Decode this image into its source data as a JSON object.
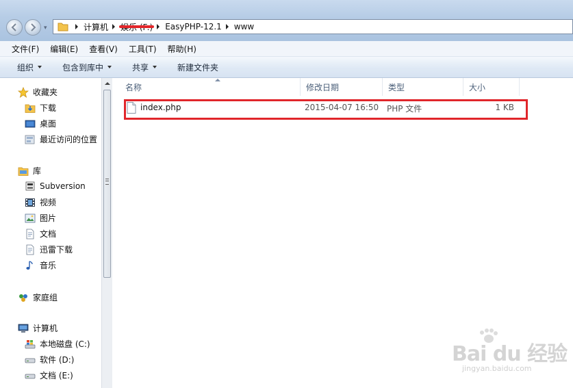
{
  "address_bar": {
    "breadcrumbs": [
      "计算机",
      "娱乐 (F:)",
      "EasyPHP-12.1",
      "www"
    ]
  },
  "menu_bar": {
    "items": [
      "文件(F)",
      "编辑(E)",
      "查看(V)",
      "工具(T)",
      "帮助(H)"
    ]
  },
  "command_bar": {
    "organize": "组织",
    "include_in_library": "包含到库中",
    "share": "共享",
    "new_folder": "新建文件夹"
  },
  "nav_pane": {
    "favorites": {
      "label": "收藏夹",
      "items": [
        "下载",
        "桌面",
        "最近访问的位置"
      ]
    },
    "libraries": {
      "label": "库",
      "items": [
        "Subversion",
        "视频",
        "图片",
        "文档",
        "迅雷下载",
        "音乐"
      ]
    },
    "homegroup": {
      "label": "家庭组"
    },
    "computer": {
      "label": "计算机",
      "items": [
        "本地磁盘 (C:)",
        "软件 (D:)",
        "文档 (E:)"
      ]
    }
  },
  "columns": {
    "name": "名称",
    "date_modified": "修改日期",
    "type": "类型",
    "size": "大小"
  },
  "files": [
    {
      "name": "index.php",
      "date_modified": "2015-04-07 16:50",
      "type": "PHP 文件",
      "size": "1 KB"
    }
  ],
  "watermark": {
    "brand": "Bai du 经验",
    "url": "jingyan.baidu.com"
  },
  "colors": {
    "highlight": "#e0262b",
    "header_text": "#4c607a"
  }
}
